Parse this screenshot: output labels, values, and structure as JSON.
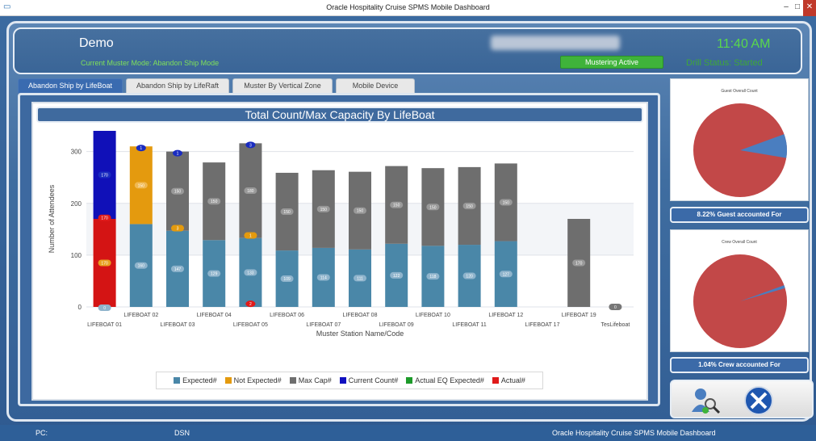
{
  "window": {
    "title": "Oracle Hospitality Cruise SPMS Mobile Dashboard",
    "min": "–",
    "max": "□",
    "close": "✕"
  },
  "header": {
    "ship": "Demo",
    "muster_mode": "Current Muster Mode: Abandon Ship Mode",
    "mustering_button": "Mustering Active",
    "time": "11:40 AM",
    "drill_status": "Drill Status: Started"
  },
  "tabs": [
    {
      "label": "Abandon Ship by LifeBoat",
      "active": true
    },
    {
      "label": "Abandon Ship by LifeRaft",
      "active": false
    },
    {
      "label": "Muster By Vertical Zone",
      "active": false
    },
    {
      "label": "Mobile Device",
      "active": false
    }
  ],
  "chart_data": {
    "type": "bar",
    "title": "Total Count/Max Capacity By LifeBoat",
    "xlabel": "Muster Station Name/Code",
    "ylabel": "Number of Attendees",
    "ylim": [
      0,
      340
    ],
    "yticks": [
      0,
      100,
      200,
      300
    ],
    "categories": [
      "LIFEBOAT 01",
      "LIFEBOAT 02",
      "LIFEBOAT 03",
      "LIFEBOAT 04",
      "LIFEBOAT 05",
      "LIFEBOAT 06",
      "LIFEBOAT 07",
      "LIFEBOAT 08",
      "LIFEBOAT 09",
      "LIFEBOAT 10",
      "LIFEBOAT 11",
      "LIFEBOAT 12",
      "LIFEBOAT 17",
      "LIFEBOAT 19",
      "TesLifeboat"
    ],
    "series": [
      {
        "name": "Expected#",
        "color": "#4a87a8",
        "values": [
          0,
          160,
          147,
          129,
          133,
          109,
          114,
          111,
          122,
          118,
          120,
          127,
          0,
          0,
          0
        ]
      },
      {
        "name": "Not Expected#",
        "color": "#e49a0e",
        "values": [
          0,
          150,
          3,
          0,
          1,
          0,
          0,
          0,
          0,
          0,
          0,
          0,
          0,
          0,
          0
        ]
      },
      {
        "name": "Max Cap#",
        "color": "#6e6e6e",
        "values": [
          0,
          0,
          150,
          150,
          180,
          150,
          150,
          150,
          150,
          150,
          150,
          150,
          0,
          170,
          0
        ]
      },
      {
        "name": "Current Count#",
        "color": "#1010c0",
        "values": [
          170,
          0,
          1,
          0,
          3,
          0,
          0,
          0,
          0,
          0,
          0,
          0,
          0,
          0,
          0
        ]
      },
      {
        "name": "Actual EQ Expected#",
        "color": "#1d9a2a",
        "values": [
          0,
          0,
          0,
          0,
          0,
          0,
          0,
          0,
          0,
          0,
          0,
          0,
          0,
          0,
          0
        ]
      },
      {
        "name": "Actual#",
        "color": "#e01a1a",
        "values": [
          170,
          0,
          0,
          0,
          2,
          0,
          0,
          0,
          0,
          0,
          0,
          0,
          0,
          0,
          0
        ]
      }
    ],
    "bar_labels": {
      "expected": [
        "0",
        "160",
        "147",
        "129",
        "133",
        "109",
        "114",
        "111",
        "122",
        "118",
        "120",
        "127",
        "",
        "",
        ""
      ],
      "notexpected": [
        "170",
        "150",
        "3",
        "",
        "1",
        "",
        "",
        "",
        "",
        "",
        "",
        "",
        "",
        "",
        ""
      ],
      "maxcap": [
        "",
        "",
        "150",
        "150",
        "180",
        "150",
        "150",
        "150",
        "150",
        "150",
        "150",
        "150",
        "",
        "170",
        "0"
      ],
      "current": [
        "170",
        "1",
        "1",
        "",
        "3",
        "",
        "",
        "",
        "",
        "",
        "",
        "",
        "",
        "",
        ""
      ],
      "actual": [
        "170",
        "",
        "",
        "",
        "2",
        "",
        "",
        "",
        "",
        "",
        "",
        "",
        "",
        "",
        ""
      ]
    },
    "bar_totals": [
      340,
      310,
      300,
      279,
      316,
      259,
      264,
      261,
      272,
      268,
      270,
      277,
      0,
      170,
      0
    ],
    "legend_position": "bottom"
  },
  "pies": [
    {
      "title": "Guest Overall Count",
      "caption": "8.22% Guest accounted For",
      "percent": 8.22
    },
    {
      "title": "Crew Overall Count",
      "caption": "1.04% Crew accounted For",
      "percent": 1.04
    }
  ],
  "tools": {
    "person_search": "person-search-icon",
    "settings": "tools-icon"
  },
  "status": {
    "pc": "PC:",
    "dsn": "DSN",
    "product": "Oracle Hospitality Cruise SPMS Mobile Dashboard"
  }
}
